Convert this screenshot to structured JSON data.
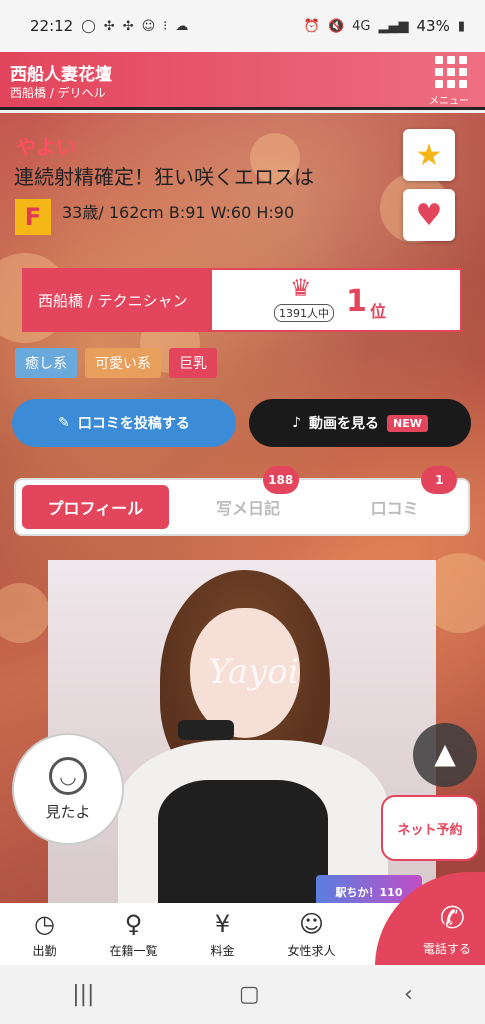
{
  "status": {
    "time": "22:12",
    "icons": [
      "chat-icon",
      "pinwheel-icon",
      "pinwheel-icon",
      "ghost-icon",
      "dots-icon",
      "cloud-icon"
    ],
    "battery": "43%",
    "network": "4G"
  },
  "header": {
    "shop_name": "西船人妻花壇",
    "sub": "西船橋 / デリヘル",
    "menu_label": "メニュー"
  },
  "profile": {
    "name": "やよい",
    "catchphrase": "連続射精確定！狂い咲くエロスは",
    "cup": "F",
    "specs": "33歳/ 162cm B:91 W:60 H:90"
  },
  "rank": {
    "area": "西船橋 / テクニシャン",
    "total": "1391人中",
    "position": "1",
    "unit": "位"
  },
  "tags": [
    {
      "label": "癒し系",
      "color": "#6aa9dc"
    },
    {
      "label": "可愛い系",
      "color": "#e89f5b"
    },
    {
      "label": "巨乳",
      "color": "#e2455c"
    }
  ],
  "actions": {
    "review": "口コミを投稿する",
    "video": "動画を見る",
    "new": "NEW"
  },
  "tabs": [
    {
      "label": "プロフィール",
      "badge": ""
    },
    {
      "label": "写メ日記",
      "badge": "188"
    },
    {
      "label": "口コミ",
      "badge": "1"
    }
  ],
  "photo": {
    "watermark": "Yayoi"
  },
  "floating": {
    "mita": "見たよ",
    "net_reserve": "ネット予約",
    "banner": "駅ちか！110"
  },
  "bottom_nav": [
    {
      "label": "出勤",
      "icon": "clock-icon"
    },
    {
      "label": "在籍一覧",
      "icon": "person-icon"
    },
    {
      "label": "料金",
      "icon": "yen-icon"
    },
    {
      "label": "女性求人",
      "icon": "woman-icon"
    }
  ],
  "call": {
    "label": "電話する"
  }
}
